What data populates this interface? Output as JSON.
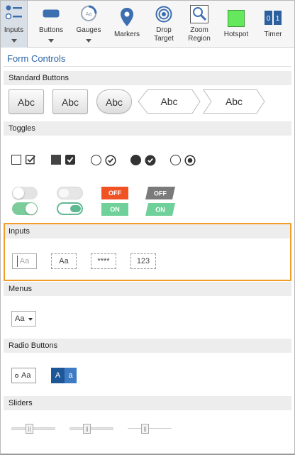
{
  "toolbar": {
    "items": [
      {
        "label": "Inputs",
        "icon": "inputs-icon"
      },
      {
        "label": "Buttons",
        "icon": "buttons-icon"
      },
      {
        "label": "Gauges",
        "icon": "gauge-icon",
        "icon_text": "Aa"
      },
      {
        "label": "Markers",
        "icon": "map-marker-icon"
      },
      {
        "label": "Drop",
        "label2": "Target",
        "icon": "target-icon"
      },
      {
        "label": "Zoom",
        "label2": "Region",
        "icon": "zoom-icon"
      },
      {
        "label": "Hotspot",
        "icon": "hotspot-icon"
      },
      {
        "label": "Timer",
        "icon": "timer-icon",
        "digits": [
          "0",
          "1"
        ]
      }
    ]
  },
  "panel": {
    "title": "Form Controls",
    "sections": {
      "standard_buttons": "Standard Buttons",
      "toggles": "Toggles",
      "inputs": "Inputs",
      "menus": "Menus",
      "radio_buttons": "Radio Buttons",
      "sliders": "Sliders"
    }
  },
  "standard_buttons": [
    "Abc",
    "Abc",
    "Abc",
    "Abc",
    "Abc"
  ],
  "toggles": {
    "off_label": "OFF",
    "on_label": "ON"
  },
  "inputs": {
    "plain_placeholder": "Aa",
    "text_value": "Aa",
    "password_value": "****",
    "number_value": "123"
  },
  "menus": {
    "dropdown_value": "Aa"
  },
  "radio_buttons": {
    "option_label": "Aa",
    "segment_a": "A",
    "segment_b": "a"
  },
  "colors": {
    "accent_blue": "#2a63a6",
    "highlight_orange": "#f39c2a",
    "toggle_on_green": "#7ccc9b",
    "badge_off_red": "#f05224",
    "badge_off_gray": "#7a7a7a",
    "badge_on_green": "#6fd09a",
    "hotspot_green": "#64e85c",
    "segment_dark": "#1e5797",
    "segment_light": "#3e7bc4"
  }
}
